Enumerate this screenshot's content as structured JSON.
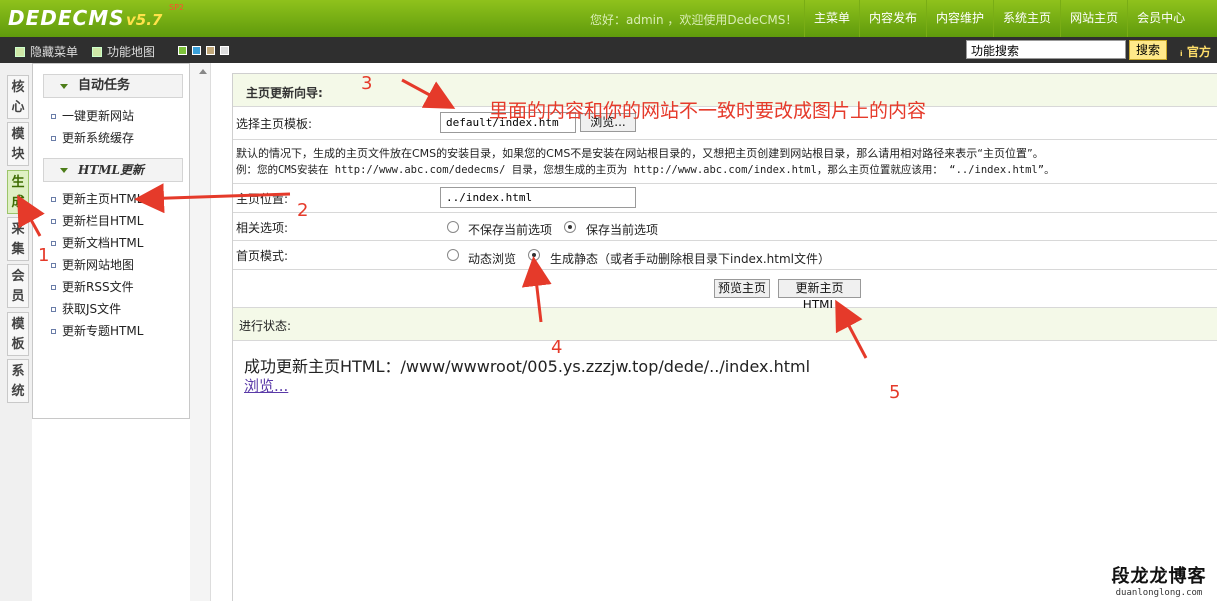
{
  "header": {
    "logo": "DEDECMS",
    "version": "v5.7",
    "edition": "SP2",
    "welcome": "您好：admin ，欢迎使用DedeCMS！",
    "nav": [
      "主菜单",
      "内容发布",
      "内容维护",
      "系统主页",
      "网站主页",
      "会员中心"
    ]
  },
  "toolbar": {
    "hide_menu": "隐藏菜单",
    "feature_map": "功能地图",
    "swatches": [
      "#7dc23b",
      "#3aa0d9",
      "#c0a77a",
      "#dcdcdc"
    ],
    "search_value": "功能搜索",
    "search_button": "搜索",
    "official": "官方"
  },
  "left_tabs": [
    {
      "label": "核心"
    },
    {
      "label": "模块"
    },
    {
      "label": "生成"
    },
    {
      "label": "采集"
    },
    {
      "label": "会员"
    },
    {
      "label": "模板"
    },
    {
      "label": "系统"
    }
  ],
  "left_menu": {
    "group1": {
      "title": "自动任务",
      "items": [
        "一键更新网站",
        "更新系统缓存"
      ]
    },
    "group2": {
      "title": "HTML更新",
      "items": [
        "更新主页HTML",
        "更新栏目HTML",
        "更新文档HTML",
        "更新网站地图",
        "更新RSS文件",
        "获取JS文件",
        "更新专题HTML"
      ]
    }
  },
  "main": {
    "title": "主页更新向导:",
    "template_label": "选择主页模板:",
    "template_value": "default/index.htm",
    "browse_button": "浏览...",
    "note_line1": "默认的情况下，生成的主页文件放在CMS的安装目录，如果您的CMS不是安装在网站根目录的，又想把主页创建到网站根目录，那么请用相对路径来表示“主页位置”。",
    "note_line2": "例：您的CMS安装在 http://www.abc.com/dedecms/ 目录，您想生成的主页为 http://www.abc.com/index.html，那么主页位置就应该用： “../index.html”。",
    "position_label": "主页位置:",
    "position_value": "../index.html",
    "options_label": "相关选项:",
    "opt_no_save": "不保存当前选项",
    "opt_save": "保存当前选项",
    "mode_label": "首页模式:",
    "mode_dynamic": "动态浏览",
    "mode_static": "生成静态（或者手动删除根目录下index.html文件）",
    "preview_button": "预览主页",
    "update_button": "更新主页HTML",
    "status_label": "进行状态:",
    "result_text": "成功更新主页HTML：/www/wwwroot/005.ys.zzzjw.top/dede/../index.html",
    "result_link": "浏览..."
  },
  "annotations": {
    "n1": "1",
    "n2": "2",
    "n3": "3",
    "n4": "4",
    "n5": "5",
    "note": "里面的内容和你的网站不一致时要改成图片上的内容",
    "arrow_color": "#e53a2a"
  },
  "watermark": {
    "title": "段龙龙博客",
    "domain": "duanlonglong.com"
  }
}
